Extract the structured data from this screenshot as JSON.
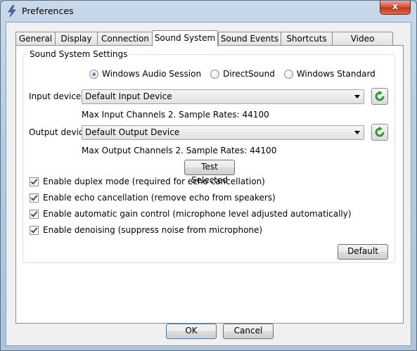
{
  "window": {
    "title": "Preferences",
    "close_glyph": "x"
  },
  "tabs": [
    {
      "label": "General"
    },
    {
      "label": "Display"
    },
    {
      "label": "Connection"
    },
    {
      "label": "Sound System",
      "active": true
    },
    {
      "label": "Sound Events"
    },
    {
      "label": "Shortcuts"
    },
    {
      "label": "Video Capture"
    }
  ],
  "group": {
    "title": "Sound System Settings",
    "radio_options": [
      {
        "label": "Windows Audio Session",
        "selected": true
      },
      {
        "label": "DirectSound",
        "selected": false
      },
      {
        "label": "Windows Standard",
        "selected": false
      }
    ],
    "input_device": {
      "label": "Input device",
      "value": "Default Input Device",
      "info": "Max Input Channels 2. Sample Rates: 44100"
    },
    "output_device": {
      "label": "Output device",
      "value": "Default Output Device",
      "info": "Max Output Channels 2. Sample Rates: 44100"
    },
    "test_button": "Test Selected"
  },
  "options": [
    {
      "label": "Enable duplex mode (required for echo cancellation)",
      "checked": true
    },
    {
      "label": "Enable echo cancellation (remove echo from speakers)",
      "checked": true
    },
    {
      "label": "Enable automatic gain control (microphone level adjusted automatically)",
      "checked": true
    },
    {
      "label": "Enable denoising (suppress noise from microphone)",
      "checked": true
    }
  ],
  "default_button": "Default",
  "ok_button": "OK",
  "cancel_button": "Cancel",
  "icons": {
    "app": "app-logo-icon",
    "refresh": "refresh-icon"
  },
  "colors": {
    "refresh_green": "#2e9a2e",
    "close_red": "#c9432a"
  }
}
